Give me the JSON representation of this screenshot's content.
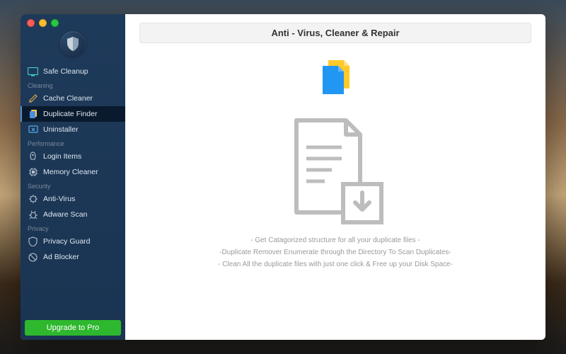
{
  "header": {
    "title": "Anti - Virus, Cleaner & Repair"
  },
  "sidebar": {
    "items": [
      {
        "label": "Safe Cleanup"
      },
      {
        "label": "Cache Cleaner"
      },
      {
        "label": "Duplicate Finder"
      },
      {
        "label": "Uninstaller"
      },
      {
        "label": "Login Items"
      },
      {
        "label": "Memory Cleaner"
      },
      {
        "label": "Anti-Virus"
      },
      {
        "label": "Adware Scan"
      },
      {
        "label": "Privacy Guard"
      },
      {
        "label": "Ad Blocker"
      }
    ],
    "sections": {
      "cleaning": "Cleaning",
      "performance": "Performance",
      "security": "Security",
      "privacy": "Privacy"
    },
    "upgrade_label": "Upgrade to Pro"
  },
  "main": {
    "desc1": "- Get Catagorized structure for all your duplicate files -",
    "desc2": "-Duplicate Remover Enumerate through the Directory To Scan Duplicates-",
    "desc3": "- Clean All the duplicate files with just one click & Free up your Disk Space-"
  }
}
